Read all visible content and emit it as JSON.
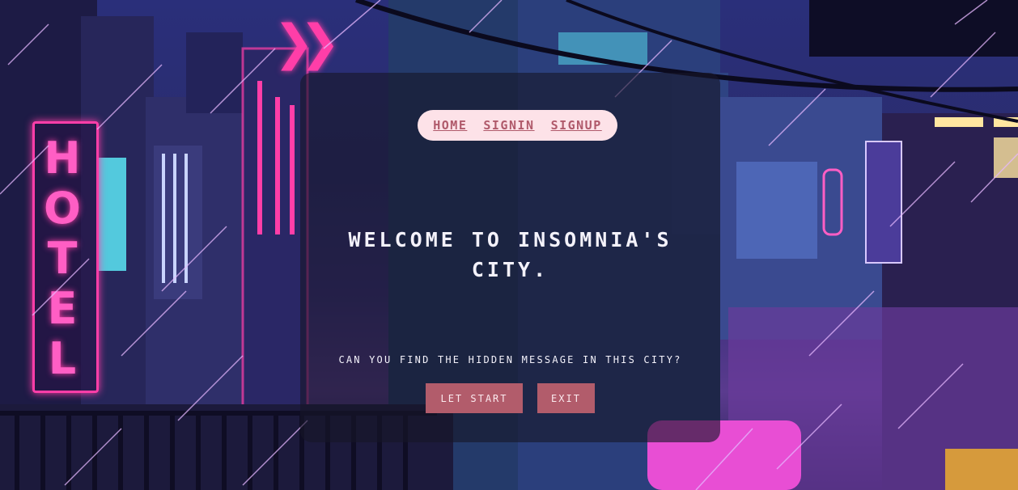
{
  "nav": {
    "home": "HOME",
    "signin": "SIGNIN",
    "signup": "SIGNUP"
  },
  "hero": {
    "title_line1": "WELCOME TO INSOMNIA'S",
    "title_line2": "CITY.",
    "tagline": "CAN YOU FIND THE HIDDEN MESSAGE IN THIS CITY?"
  },
  "buttons": {
    "start": "LET START",
    "exit": "EXIT"
  },
  "background": {
    "scene": "pixel-art rainy neon city",
    "sign_text": "HOTEL",
    "accent_color": "#ff3ea8",
    "button_color": "#b25c6b",
    "nav_bg_color": "#fde2e8"
  }
}
